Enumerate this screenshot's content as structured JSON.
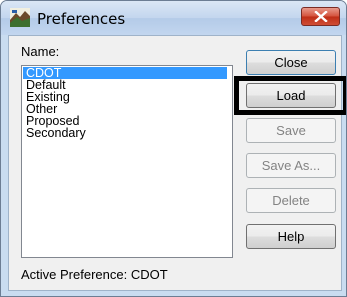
{
  "window": {
    "title": "Preferences",
    "icon": "preferences-app-icon"
  },
  "list": {
    "label": "Name:",
    "items": [
      {
        "label": "CDOT",
        "selected": true
      },
      {
        "label": "Default",
        "selected": false
      },
      {
        "label": "Existing",
        "selected": false
      },
      {
        "label": "Other",
        "selected": false
      },
      {
        "label": "Proposed",
        "selected": false
      },
      {
        "label": "Secondary",
        "selected": false
      }
    ]
  },
  "buttons": {
    "close": "Close",
    "load": "Load",
    "save": "Save",
    "save_as": "Save As...",
    "delete": "Delete",
    "help": "Help"
  },
  "status": {
    "active_preference": "Active Preference: CDOT"
  },
  "colors": {
    "selection": "#3399ff",
    "highlight_frame": "#000000",
    "titlebar_close": "#c42b1c"
  }
}
